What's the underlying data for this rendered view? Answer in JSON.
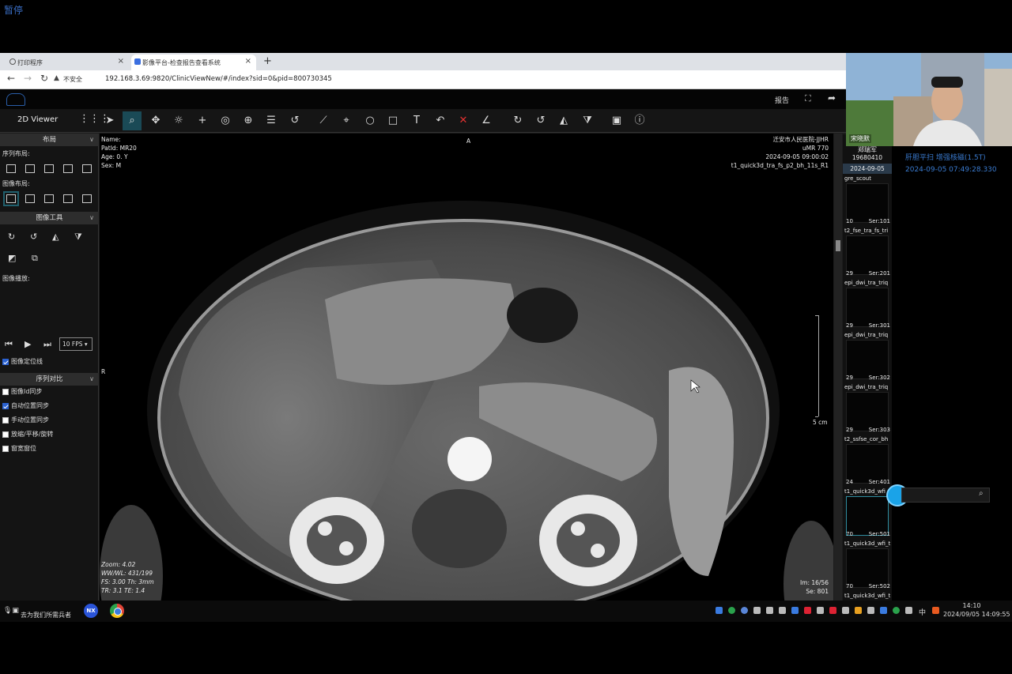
{
  "overlay_top_left": "暂停",
  "browser": {
    "tabs": [
      {
        "label": "打印程序",
        "close": "×"
      },
      {
        "label": "影像平台-检查报告查看系统",
        "close": "×"
      }
    ],
    "new_tab": "+",
    "security_label": "不安全",
    "url": "192.168.3.69:9820/ClinicViewNew/#/index?sid=0&pid=800730345"
  },
  "app": {
    "report_label": "报告",
    "viewer_title": "2D Viewer"
  },
  "sidebar": {
    "layout_header": "布局",
    "series_layout_label": "序列布局:",
    "image_layout_label": "图像布局:",
    "image_tools_header": "图像工具",
    "playback_label": "图像播放:",
    "fps_value": "10 FPS",
    "localizer_label": "图像定位线",
    "compare_header": "序列对比",
    "checkboxes": [
      {
        "label": "图像Id同步",
        "checked": false
      },
      {
        "label": "自动位置同步",
        "checked": true
      },
      {
        "label": "手动位置同步",
        "checked": false
      },
      {
        "label": "放缩/平移/旋转",
        "checked": false
      },
      {
        "label": "窗宽窗位",
        "checked": false
      }
    ]
  },
  "viewport": {
    "top_left": [
      "Name:",
      "PatId: MR20",
      "Age: 0. Y",
      "Sex: M"
    ],
    "top_center": "A",
    "top_right": [
      "迁安市人民医院-JJHR",
      "uMR 770",
      "2024-09-05  09:00:02",
      "t1_quick3d_tra_fs_p2_bh_11s_R1"
    ],
    "left_mid": "R",
    "scale_label": "5 cm",
    "bottom_left": [
      "Zoom: 4.02",
      "WW/WL: 431/199",
      "FS: 3.00  Th: 3mm",
      "TR: 3.1  TE: 1.4"
    ],
    "bottom_right": [
      "Im: 16/56",
      "Se: 801"
    ]
  },
  "series_panel": {
    "patient_name": "郑瑞军",
    "patient_id": "19680410",
    "study_date": "2024-09-05",
    "series": [
      {
        "name": "gre_scout",
        "count": "10",
        "ser": "Ser:101"
      },
      {
        "name": "t2_fse_tra_fs_tri",
        "count": "29",
        "ser": "Ser:201"
      },
      {
        "name": "epi_dwi_tra_triq",
        "count": "29",
        "ser": "Ser:301"
      },
      {
        "name": "epi_dwi_tra_triq",
        "count": "29",
        "ser": "Ser:302"
      },
      {
        "name": "epi_dwi_tra_triq",
        "count": "29",
        "ser": "Ser:303"
      },
      {
        "name": "t2_ssfse_cor_bh",
        "count": "24",
        "ser": "Ser:401"
      },
      {
        "name": "t1_quick3d_wfi",
        "count": "70",
        "ser": "Ser:501"
      },
      {
        "name": "t1_quick3d_wfi_t",
        "count": "70",
        "ser": "Ser:502"
      },
      {
        "name": "t1_quick3d_wfi_t",
        "count": "",
        "ser": ""
      }
    ]
  },
  "webcam": {
    "name": "宋晓默"
  },
  "right_info": {
    "line1": "肝胆平扫 增强核磁(1.5T)",
    "line2": "2024-09-05 07:49:28.330"
  },
  "taskbar": {
    "search_text": "去为我们所需兵者",
    "nx_label": "NX",
    "ime": "中",
    "time": "14:10",
    "date": "2024/09/05 14:09:55"
  }
}
